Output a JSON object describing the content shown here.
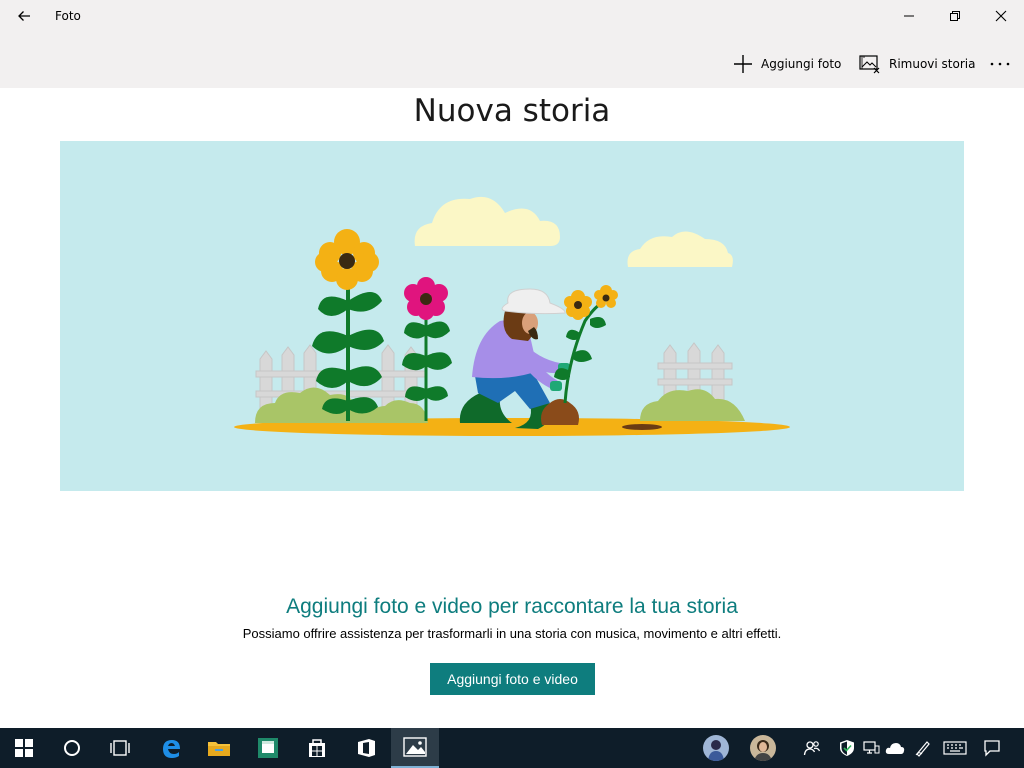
{
  "app": {
    "title": "Foto"
  },
  "commands": {
    "add_photos": "Aggiungi foto",
    "remove_story": "Rimuovi storia"
  },
  "story": {
    "title": "Nuova storia"
  },
  "cta": {
    "heading": "Aggiungi foto e video per raccontare la tua storia",
    "subtitle": "Possiamo offrire assistenza per trasformarli in una storia con musica, movimento e altri effetti.",
    "button": "Aggiungi foto e video"
  },
  "taskbar": {
    "items": [
      "start-icon",
      "cortana-icon",
      "task-view-icon",
      "edge-icon",
      "file-explorer-icon",
      "store-app-icon",
      "microsoft-store-icon",
      "office-icon",
      "photos-icon"
    ],
    "active": "photos-icon",
    "tray": [
      "avatar-1",
      "avatar-2",
      "people-icon",
      "defender-icon",
      "network-icon",
      "onedrive-icon",
      "pen-icon",
      "keyboard-icon",
      "notifications-icon"
    ]
  },
  "colors": {
    "accent": "#0e7d7e",
    "chrome": "#f2f0f0",
    "hero_bg": "#c5eaed",
    "taskbar": "#0e1d29"
  }
}
